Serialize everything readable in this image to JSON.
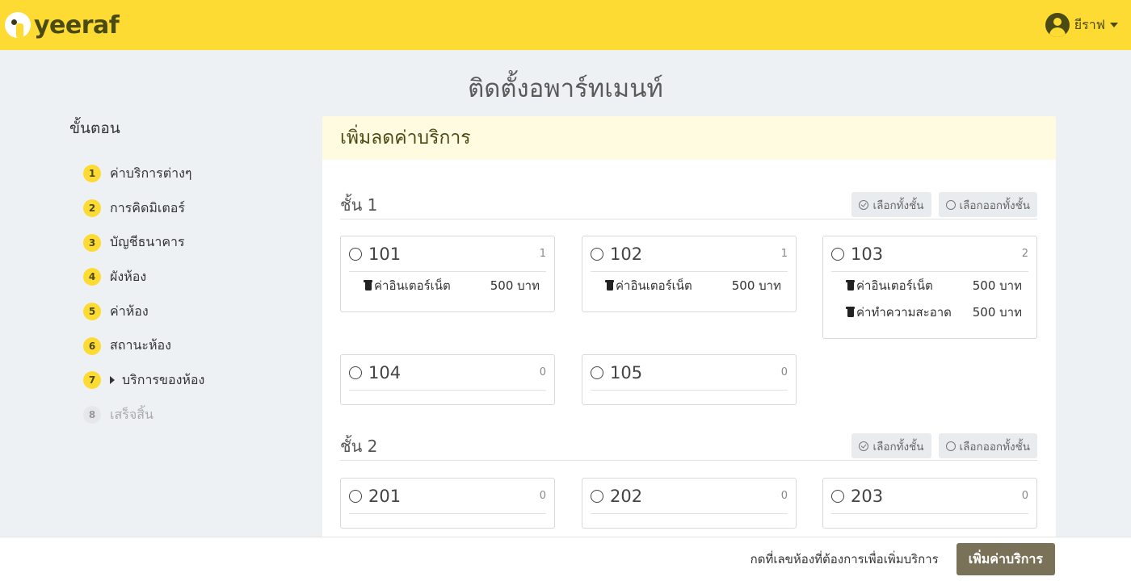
{
  "header": {
    "brand": "yeeraf",
    "user_name": "ยีราฟ"
  },
  "page_title": "ติดตั้งอพาร์ทเมนท์",
  "sidebar": {
    "title": "ขั้นตอน",
    "steps": [
      {
        "num": "1",
        "label": "ค่าบริการต่างๆ"
      },
      {
        "num": "2",
        "label": "การคิดมิเตอร์"
      },
      {
        "num": "3",
        "label": "บัญชีธนาคาร"
      },
      {
        "num": "4",
        "label": "ผังห้อง"
      },
      {
        "num": "5",
        "label": "ค่าห้อง"
      },
      {
        "num": "6",
        "label": "สถานะห้อง"
      },
      {
        "num": "7",
        "label": "บริการของห้อง"
      },
      {
        "num": "8",
        "label": "เสร็จสิ้น"
      }
    ]
  },
  "panel": {
    "title": "เพิ่มลดค่าบริการ",
    "select_all_label": "เลือกทั้งชั้น",
    "deselect_all_label": "เลือกออกทั้งชั้น",
    "floors": [
      {
        "name": "ชั้น 1",
        "rooms": [
          {
            "number": "101",
            "count": "1",
            "services": [
              {
                "name": "ค่าอินเตอร์เน็ต",
                "price": "500 บาท"
              }
            ]
          },
          {
            "number": "102",
            "count": "1",
            "services": [
              {
                "name": "ค่าอินเตอร์เน็ต",
                "price": "500 บาท"
              }
            ]
          },
          {
            "number": "103",
            "count": "2",
            "services": [
              {
                "name": "ค่าอินเตอร์เน็ต",
                "price": "500 บาท"
              },
              {
                "name": "ค่าทำความสะอาด",
                "price": "500 บาท"
              }
            ]
          },
          {
            "number": "104",
            "count": "0",
            "services": []
          },
          {
            "number": "105",
            "count": "0",
            "services": []
          }
        ]
      },
      {
        "name": "ชั้น 2",
        "rooms": [
          {
            "number": "201",
            "count": "0",
            "services": []
          },
          {
            "number": "202",
            "count": "0",
            "services": []
          },
          {
            "number": "203",
            "count": "0",
            "services": []
          }
        ]
      }
    ]
  },
  "footer": {
    "hint": "กดที่เลขห้องที่ต้องการเพื่อเพิ่มบริการ",
    "add_button": "เพิ่มค่าบริการ"
  },
  "colors": {
    "header_bg": "#fddb33",
    "panel_head_bg": "#fefbe0",
    "primary_button": "#7a7258",
    "page_bg": "#eef1f4"
  }
}
